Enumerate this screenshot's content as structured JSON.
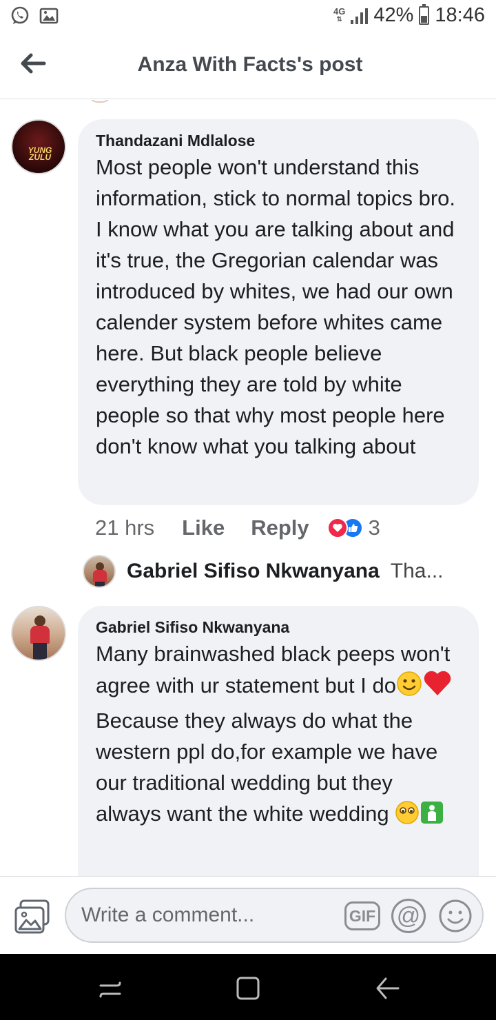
{
  "status_bar": {
    "network": "4G",
    "battery": "42%",
    "battery_level": 0.42,
    "time": "18:46"
  },
  "header": {
    "title": "Anza With Facts's post"
  },
  "comments": [
    {
      "author": "Thandazani Mdlalose",
      "avatar_text": "YUNG ZULU",
      "text": "Most people won't understand this information, stick to normal topics bro. I know what you are talking about and it's true, the Gregorian calendar was introduced by whites, we had our own calender system before whites came here. But black people believe everything they are told by white people so that why most people here don't know what you talking about",
      "time": "21 hrs",
      "like_label": "Like",
      "reply_label": "Reply",
      "reaction_count": "3",
      "reply_preview": {
        "author": "Gabriel Sifiso Nkwanyana",
        "preview": "Tha..."
      }
    },
    {
      "author": "Gabriel Sifiso Nkwanyana",
      "text_part1": "Many brainwashed black peeps won't agree with ur statement but I do",
      "text_part2": "Because they always do what the western ppl do,for example we have our traditional wedding but they always want the white wedding"
    }
  ],
  "composer": {
    "placeholder": "Write a comment...",
    "gif_label": "GIF",
    "at_label": "@"
  },
  "colors": {
    "bubble": "#f0f2f5",
    "like_blue": "#1877f2",
    "heart_red": "#f02849",
    "meta_gray": "#65676b"
  }
}
